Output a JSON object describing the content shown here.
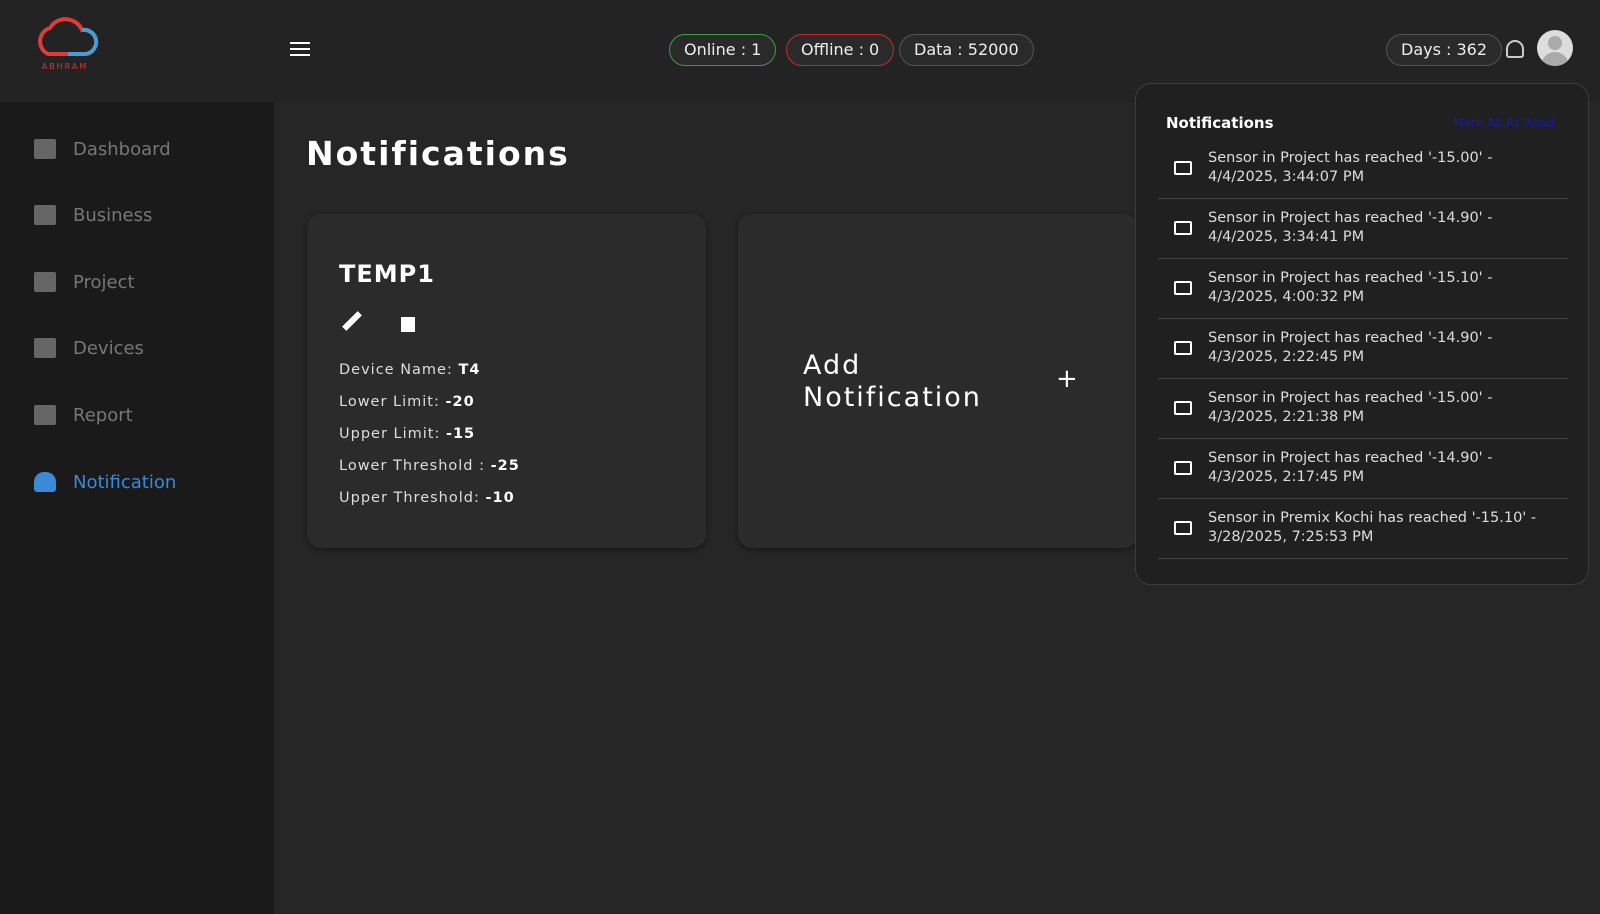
{
  "header": {
    "logo_text": "ABHRAM",
    "online": "Online  :  1",
    "offline": "Offline : 0",
    "data": "Data : 52000",
    "days": "Days : 362"
  },
  "sidebar": {
    "items": [
      {
        "label": "Dashboard"
      },
      {
        "label": "Business"
      },
      {
        "label": "Project"
      },
      {
        "label": "Devices"
      },
      {
        "label": "Report"
      },
      {
        "label": "Notification"
      }
    ]
  },
  "main": {
    "title": "Notifications",
    "card": {
      "name": "TEMP1",
      "rows": [
        {
          "label": "Device Name: ",
          "value": "T4"
        },
        {
          "label": "Lower Limit: ",
          "value": "-20"
        },
        {
          "label": "Upper Limit: ",
          "value": "-15"
        },
        {
          "label": "Lower Threshold : ",
          "value": "-25"
        },
        {
          "label": "Upper Threshold: ",
          "value": "-10"
        }
      ]
    },
    "add_label": "Add Notification",
    "add_icon": "+"
  },
  "dropdown": {
    "title": "Notifications",
    "mark_all": "Mark All As Read",
    "items": [
      "Sensor in Project has reached '-15.00' - 4/4/2025, 3:44:07 PM",
      "Sensor in Project has reached '-14.90' - 4/4/2025, 3:34:41 PM",
      "Sensor in Project has reached '-15.10' - 4/3/2025, 4:00:32 PM",
      "Sensor in Project has reached '-14.90' - 4/3/2025, 2:22:45 PM",
      "Sensor in Project has reached '-15.00' - 4/3/2025, 2:21:38 PM",
      "Sensor in Project has reached '-14.90' - 4/3/2025, 2:17:45 PM",
      "Sensor in Premix Kochi has reached '-15.10' - 3/28/2025, 7:25:53 PM"
    ]
  }
}
